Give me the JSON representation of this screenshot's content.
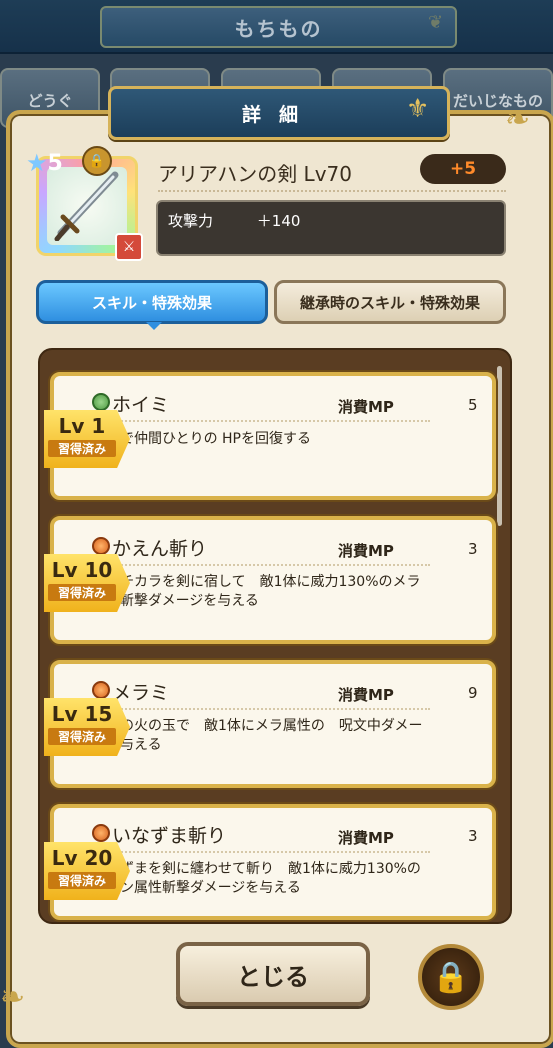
{
  "top_bar": {
    "title": "もちもの"
  },
  "background_tabs": [
    {
      "label": "どうぐ"
    },
    {
      "label": ""
    },
    {
      "label": ""
    },
    {
      "label": ""
    },
    {
      "label": "だいじなもの"
    }
  ],
  "dialog": {
    "header": "詳細",
    "item": {
      "stars": "5",
      "name": "アリアハンの剣 Lv70",
      "plus": "+5",
      "stat_label": "攻撃力",
      "stat_value": "＋140"
    },
    "tabs": [
      {
        "label": "スキル・特殊効果",
        "active": true
      },
      {
        "label": "継承時のスキル・特殊効果",
        "active": false
      }
    ],
    "mp_label": "消費MP",
    "skills": [
      {
        "level": "Lv 1",
        "status": "習得済み",
        "icon": "heal-icon",
        "name": "ホイミ",
        "mp": "5",
        "description": "呪文で仲間ひとりの HPを回復する"
      },
      {
        "level": "Lv 10",
        "status": "習得済み",
        "icon": "fire-icon",
        "name": "かえん斬り",
        "mp": "3",
        "description": "炎のチカラを剣に宿して　敵1体に威力130%のメラ属性斬撃ダメージを与える"
      },
      {
        "level": "Lv 15",
        "status": "習得済み",
        "icon": "fire-icon",
        "name": "メラミ",
        "mp": "9",
        "description": "複数の火の玉で　敵1体にメラ属性の　呪文中ダメージを与える"
      },
      {
        "level": "Lv 20",
        "status": "習得済み",
        "icon": "fire-icon",
        "name": "いなずま斬り",
        "mp": "3",
        "description": "いなずまを剣に纏わせて斬り　敵1体に威力130%のデイン属性斬撃ダメージを与える"
      }
    ],
    "close_label": "とじる"
  }
}
